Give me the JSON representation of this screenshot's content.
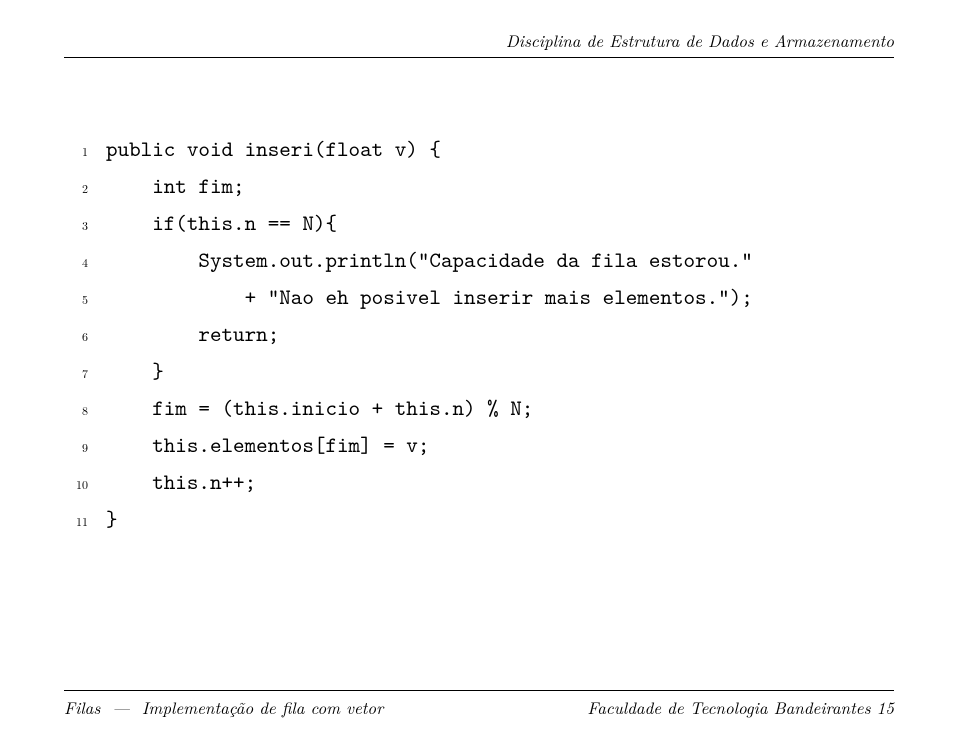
{
  "header": {
    "text": "Disciplina de Estrutura de Dados e Armazenamento"
  },
  "code": {
    "lines": [
      {
        "n": "1",
        "text": "public void inseri(float v) {"
      },
      {
        "n": "2",
        "text": "    int fim;"
      },
      {
        "n": "3",
        "text": "    if(this.n == N){"
      },
      {
        "n": "4",
        "text": "        System.out.println(\"Capacidade da fila estorou.\""
      },
      {
        "n": "5",
        "text": "            + \"Nao eh posivel inserir mais elementos.\");"
      },
      {
        "n": "6",
        "text": "        return;"
      },
      {
        "n": "7",
        "text": "    }"
      },
      {
        "n": "8",
        "text": "    fim = (this.inicio + this.n) % N;"
      },
      {
        "n": "9",
        "text": "    this.elementos[fim] = v;"
      },
      {
        "n": "10",
        "text": "    this.n++;"
      },
      {
        "n": "11",
        "text": "}"
      }
    ]
  },
  "footer": {
    "left_prefix": "Filas",
    "left_sep": "—",
    "left_suffix": "Implementação de fila com vetor",
    "right_text": "Faculdade de Tecnologia Bandeirantes",
    "page_number": "15"
  }
}
